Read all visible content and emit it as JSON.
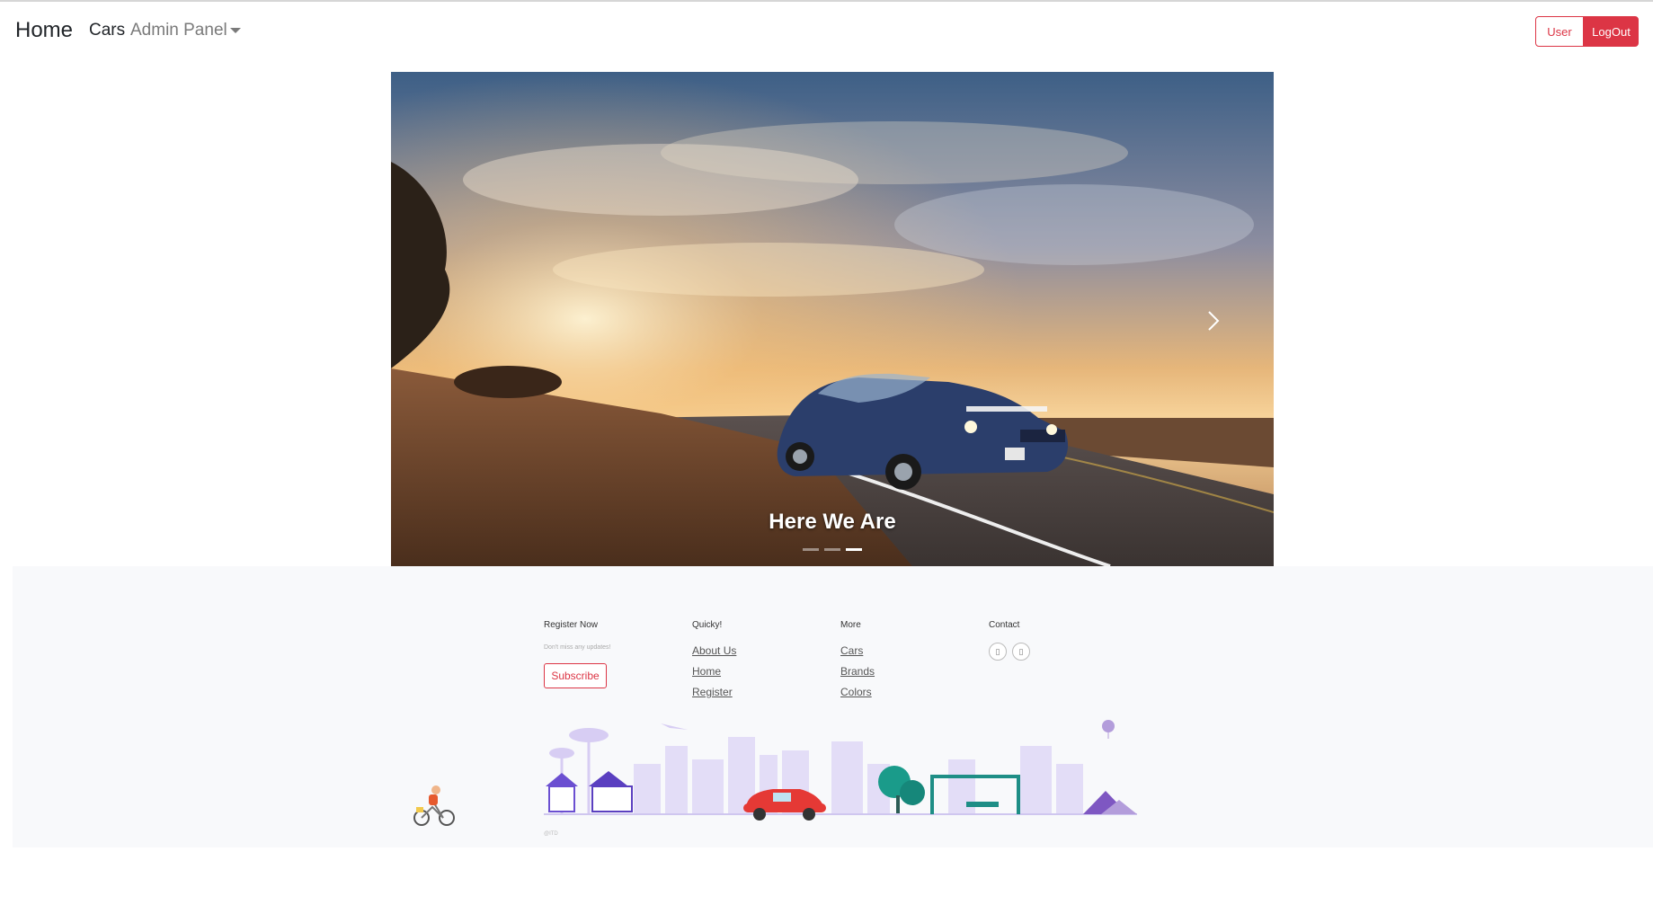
{
  "navbar": {
    "brand": "Home",
    "cars": "Cars",
    "admin_panel": "Admin Panel",
    "user_button": "User",
    "logout_button": "LogOut"
  },
  "carousel": {
    "caption": "Here We Are",
    "slide_count": 3,
    "active_index": 2
  },
  "footer": {
    "register": {
      "title": "Register Now",
      "subtitle": "Don't miss any updates!",
      "subscribe": "Subscribe"
    },
    "quick": {
      "title": "Quicky!",
      "links": [
        "About Us",
        "Home",
        "Register"
      ]
    },
    "more": {
      "title": "More",
      "links": [
        "Cars",
        "Brands",
        "Colors"
      ]
    },
    "contact": {
      "title": "Contact",
      "icons": [
        "phone-icon",
        "phone-icon"
      ]
    },
    "copyright": "@ITD"
  },
  "colors": {
    "danger": "#dc3545",
    "footer_bg": "#f8f9fb",
    "illustration": "#e3ddf7"
  }
}
